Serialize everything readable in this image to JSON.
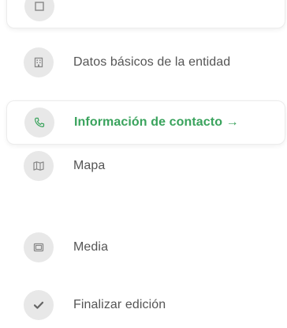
{
  "steps": [
    {
      "label": "",
      "icon": "category-icon",
      "state": "completed-card"
    },
    {
      "label": "Datos básicos de la entidad",
      "icon": "building-icon",
      "state": "default"
    },
    {
      "label": "Información de contacto",
      "arrow": "→",
      "icon": "phone-icon",
      "state": "active"
    },
    {
      "label": "Mapa",
      "icon": "map-icon",
      "state": "default"
    },
    {
      "label": "Media",
      "icon": "media-icon",
      "state": "default"
    },
    {
      "label": "Finalizar edición",
      "icon": "check-icon",
      "state": "default"
    }
  ],
  "colors": {
    "active": "#3aa35d",
    "text": "#555555",
    "icon_bg": "#e8e8e8",
    "icon_stroke": "#888888"
  }
}
